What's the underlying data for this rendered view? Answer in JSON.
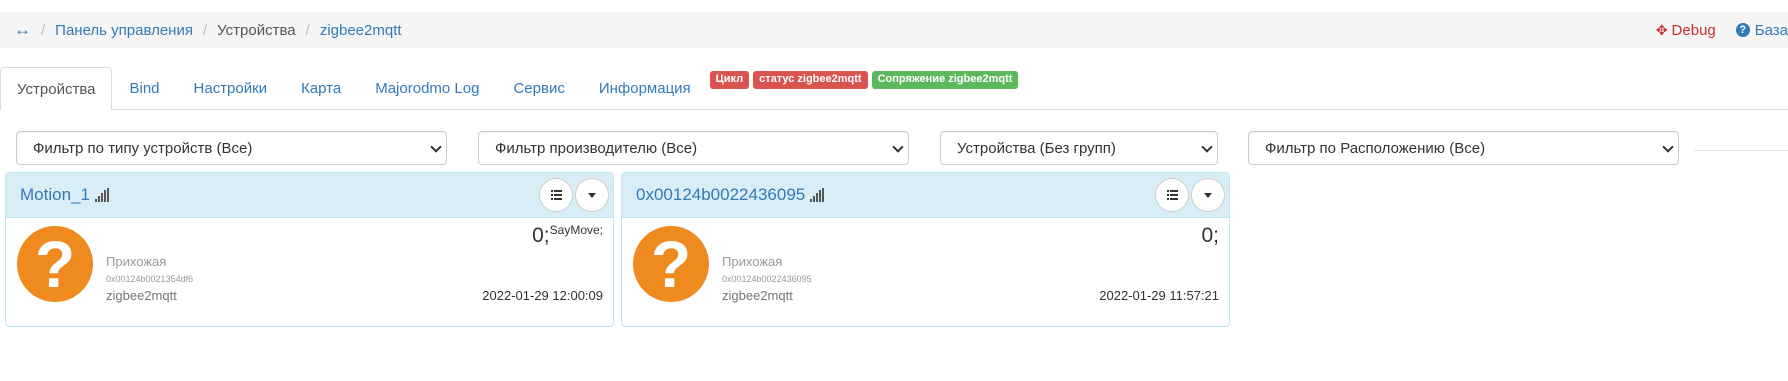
{
  "breadcrumb": {
    "home_icon": "↔",
    "items": [
      "Панель управления",
      "Устройства",
      "zigbee2mqtt"
    ]
  },
  "topright": {
    "debug": "Debug",
    "base": "База",
    "debug_icon": "crosshair-icon",
    "base_icon": "question-circle-icon"
  },
  "tabs": [
    "Устройства",
    "Bind",
    "Настройки",
    "Карта",
    "Majorodmo Log",
    "Сервис",
    "Информация"
  ],
  "badges": [
    "Цикл",
    "статус zigbee2mqtt",
    "Сопряжение zigbee2mqtt"
  ],
  "colors": {
    "link": "#337ab7",
    "danger": "#d9534f",
    "success": "#5cb85c",
    "panel_head": "#d9edf7",
    "icon_orange": "#ee8a1e"
  },
  "filters": [
    "Фильтр по типу устройств (Все)",
    "Фильтр производителю (Все)",
    "Устройства (Без групп)",
    "Фильтр по Расположению (Все)"
  ],
  "devices": [
    {
      "title": "Motion_1",
      "room": "Прихожая",
      "ieee": "0x00124b0021354df6",
      "bridge": "zigbee2mqtt",
      "value": "0;",
      "value_note": "SayMove;",
      "timestamp": "2022-01-29 12:00:09"
    },
    {
      "title": "0x00124b0022436095",
      "room": "Прихожая",
      "ieee": "0x00124b0022436095",
      "bridge": "zigbee2mqtt",
      "value": "0;",
      "value_note": "",
      "timestamp": "2022-01-29 11:57:21"
    }
  ]
}
